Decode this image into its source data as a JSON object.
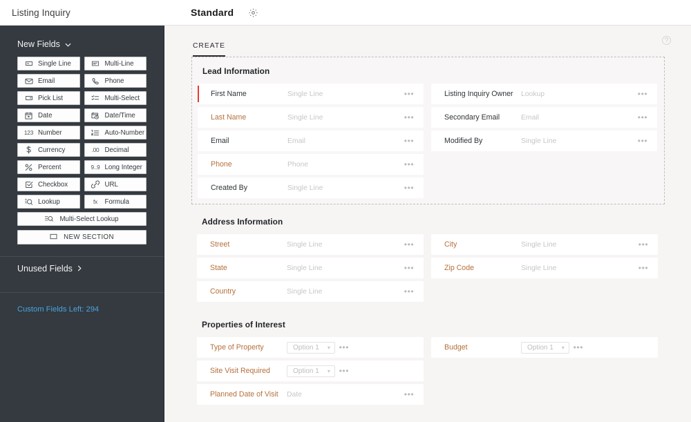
{
  "topbar": {
    "module_title": "Listing Inquiry",
    "layout_name": "Standard",
    "gear_icon": "gear-icon"
  },
  "sidebar": {
    "new_fields_label": "New Fields",
    "chevron_down_icon": "chevron-down-icon",
    "field_types": [
      {
        "label": "Single Line",
        "icon": "single-line-icon"
      },
      {
        "label": "Multi-Line",
        "icon": "multi-line-icon"
      },
      {
        "label": "Email",
        "icon": "envelope-icon"
      },
      {
        "label": "Phone",
        "icon": "phone-icon"
      },
      {
        "label": "Pick List",
        "icon": "pick-list-icon"
      },
      {
        "label": "Multi-Select",
        "icon": "multi-select-icon"
      },
      {
        "label": "Date",
        "icon": "calendar-icon"
      },
      {
        "label": "Date/Time",
        "icon": "calendar-clock-icon"
      },
      {
        "label": "Number",
        "icon": "number-123-icon"
      },
      {
        "label": "Auto-Number",
        "icon": "auto-number-icon"
      },
      {
        "label": "Currency",
        "icon": "dollar-icon"
      },
      {
        "label": "Decimal",
        "icon": "decimal-00-icon"
      },
      {
        "label": "Percent",
        "icon": "percent-icon"
      },
      {
        "label": "Long Integer",
        "icon": "long-integer-icon"
      },
      {
        "label": "Checkbox",
        "icon": "checkbox-icon"
      },
      {
        "label": "URL",
        "icon": "link-icon"
      },
      {
        "label": "Lookup",
        "icon": "lookup-magnifier-icon"
      },
      {
        "label": "Formula",
        "icon": "formula-fx-icon"
      }
    ],
    "multi_select_lookup": {
      "label": "Multi-Select Lookup",
      "icon": "multi-select-lookup-icon"
    },
    "new_section": {
      "label": "NEW SECTION",
      "icon": "section-box-icon"
    },
    "unused_fields_label": "Unused Fields",
    "chevron_right_icon": "chevron-right-icon",
    "custom_fields_left": "Custom Fields Left: 294",
    "accent_link_color": "#4aa3df",
    "background_color": "#343a40"
  },
  "main": {
    "tab_label": "CREATE",
    "help_icon": "help-circle-icon",
    "required_marker_color": "#e8392f",
    "orange_label_color": "#b5703c",
    "more_options_glyph": "•••",
    "sections": [
      {
        "title": "Lead Information",
        "selected": true,
        "left_rows": [
          {
            "label": "First Name",
            "value": "Single Line",
            "type": "text",
            "required": true,
            "orange": false
          },
          {
            "label": "Last Name",
            "value": "Single Line",
            "type": "text",
            "required": false,
            "orange": true
          },
          {
            "label": "Email",
            "value": "Email",
            "type": "text",
            "required": false,
            "orange": false
          },
          {
            "label": "Phone",
            "value": "Phone",
            "type": "text",
            "required": false,
            "orange": true
          },
          {
            "label": "Created By",
            "value": "Single Line",
            "type": "text",
            "required": false,
            "orange": false
          }
        ],
        "right_rows": [
          {
            "label": "Listing Inquiry Owner",
            "value": "Lookup",
            "type": "text",
            "required": false,
            "orange": false
          },
          {
            "label": "Secondary Email",
            "value": "Email",
            "type": "text",
            "required": false,
            "orange": false
          },
          {
            "label": "Modified By",
            "value": "Single Line",
            "type": "text",
            "required": false,
            "orange": false
          }
        ]
      },
      {
        "title": "Address Information",
        "selected": false,
        "left_rows": [
          {
            "label": "Street",
            "value": "Single Line",
            "type": "text",
            "required": false,
            "orange": true
          },
          {
            "label": "State",
            "value": "Single Line",
            "type": "text",
            "required": false,
            "orange": true
          },
          {
            "label": "Country",
            "value": "Single Line",
            "type": "text",
            "required": false,
            "orange": true
          }
        ],
        "right_rows": [
          {
            "label": "City",
            "value": "Single Line",
            "type": "text",
            "required": false,
            "orange": true
          },
          {
            "label": "Zip Code",
            "value": "Single Line",
            "type": "text",
            "required": false,
            "orange": true
          }
        ]
      },
      {
        "title": "Properties of Interest",
        "selected": false,
        "left_rows": [
          {
            "label": "Type of Property",
            "value": "Option 1",
            "type": "select",
            "required": false,
            "orange": true
          },
          {
            "label": "Site Visit Required",
            "value": "Option 1",
            "type": "select",
            "required": false,
            "orange": true
          },
          {
            "label": "Planned Date of Visit",
            "value": "Date",
            "type": "text",
            "required": false,
            "orange": true
          }
        ],
        "right_rows": [
          {
            "label": "Budget",
            "value": "Option 1",
            "type": "select",
            "required": false,
            "orange": true
          }
        ]
      }
    ]
  }
}
